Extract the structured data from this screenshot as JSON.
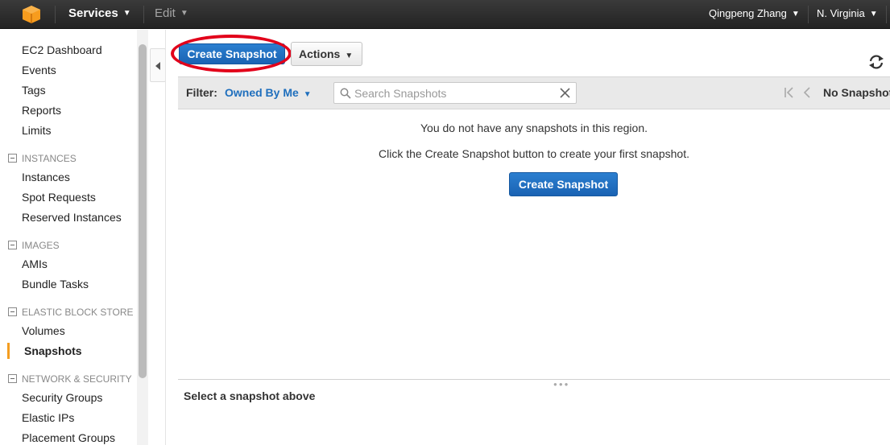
{
  "topbar": {
    "services_label": "Services",
    "edit_label": "Edit",
    "user_name": "Qingpeng Zhang",
    "region": "N. Virginia"
  },
  "sidebar": {
    "top_items": [
      "EC2 Dashboard",
      "Events",
      "Tags",
      "Reports",
      "Limits"
    ],
    "sections": [
      {
        "title": "INSTANCES",
        "items": [
          "Instances",
          "Spot Requests",
          "Reserved Instances"
        ]
      },
      {
        "title": "IMAGES",
        "items": [
          "AMIs",
          "Bundle Tasks"
        ]
      },
      {
        "title": "ELASTIC BLOCK STORE",
        "items": [
          "Volumes",
          "Snapshots"
        ]
      },
      {
        "title": "NETWORK & SECURITY",
        "items": [
          "Security Groups",
          "Elastic IPs",
          "Placement Groups"
        ]
      }
    ],
    "active_item": "Snapshots"
  },
  "toolbar": {
    "create_label": "Create Snapshot",
    "actions_label": "Actions"
  },
  "filter": {
    "label": "Filter:",
    "value": "Owned By Me",
    "search_placeholder": "Search Snapshots",
    "paging_text": "No Snapshots"
  },
  "empty_state": {
    "line1": "You do not have any snapshots in this region.",
    "line2": "Click the Create Snapshot button to create your first snapshot.",
    "button_label": "Create Snapshot"
  },
  "details": {
    "title": "Select a snapshot above"
  },
  "colors": {
    "topbar": "#232323",
    "accent_blue": "#1a63b3",
    "link_blue": "#1f6fbd",
    "active_marker": "#f49d20",
    "highlight_ring": "#e2001a"
  }
}
